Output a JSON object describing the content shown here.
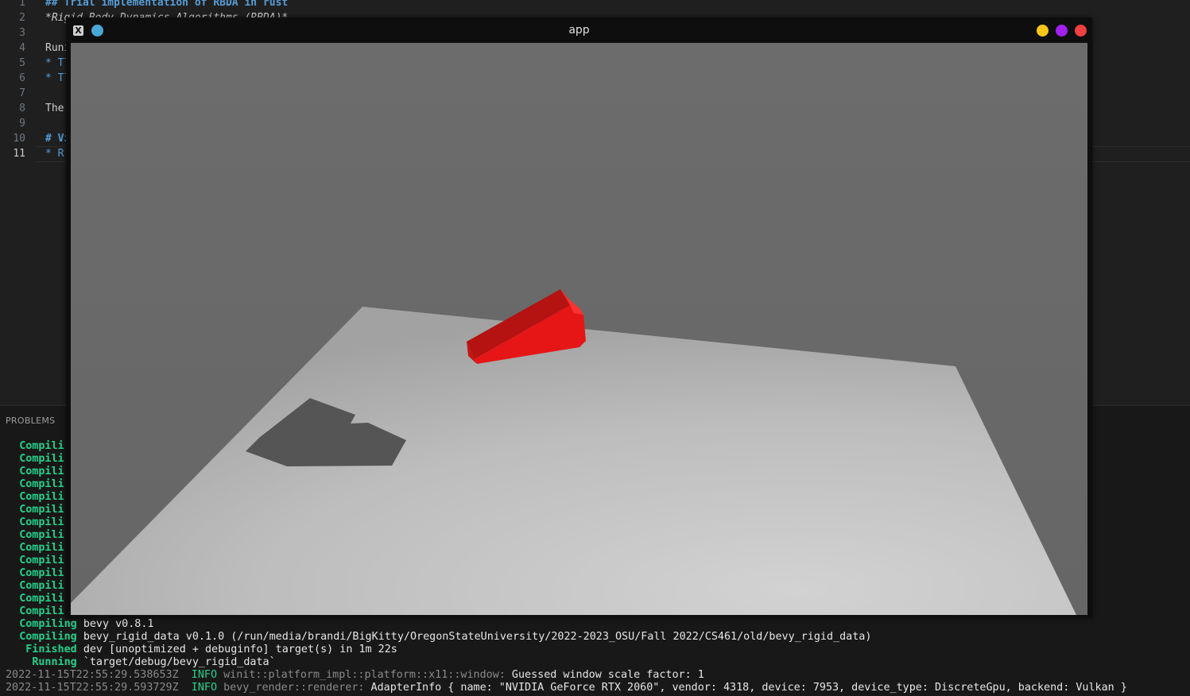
{
  "editor": {
    "line_numbers": [
      "1",
      "2",
      "3",
      "4",
      "5",
      "6",
      "7",
      "8",
      "9",
      "10",
      "11"
    ],
    "lines": [
      {
        "text": "## Trial implementation of RBDA in rust",
        "style": "h"
      },
      {
        "text": "*Rigid Body Dynamics Algorithms (RBDA)*",
        "style": "i"
      },
      {
        "text": "",
        "style": ""
      },
      {
        "text": "Runi",
        "style": ""
      },
      {
        "text": "* Tl",
        "style": "b"
      },
      {
        "text": "* Tl",
        "style": "b"
      },
      {
        "text": "",
        "style": ""
      },
      {
        "text": "The",
        "style": ""
      },
      {
        "text": "",
        "style": ""
      },
      {
        "text": "# Vi",
        "style": "h"
      },
      {
        "text": "* R(",
        "style": "b"
      }
    ]
  },
  "panel": {
    "tab_label": "PROBLEMS",
    "compiling_truncated": "Compili",
    "compiling_count": 14,
    "lines": [
      {
        "kw": "Compiling",
        "text": "bevy v0.8.1"
      },
      {
        "kw": "Compiling",
        "text": "bevy_rigid_data v0.1.0 (/run/media/brandi/BigKitty/OregonStateUniversity/2022-2023_OSU/Fall 2022/CS461/old/bevy_rigid_data)"
      },
      {
        "kw": "Finished",
        "text": "dev [unoptimized + debuginfo] target(s) in 1m 22s"
      },
      {
        "kw": "Running",
        "text": "`target/debug/bevy_rigid_data`"
      }
    ],
    "logs": [
      {
        "ts": "2022-11-15T22:55:29.538653Z",
        "level": "INFO",
        "target": "winit::platform_impl::platform::x11::window:",
        "msg": "Guessed window scale factor: 1"
      },
      {
        "ts": "2022-11-15T22:55:29.593729Z",
        "level": "INFO",
        "target": "bevy_render::renderer:",
        "msg": "AdapterInfo { name: \"NVIDIA GeForce RTX 2060\", vendor: 4318, device: 7953, device_type: DiscreteGpu, backend: Vulkan }"
      }
    ]
  },
  "app_window": {
    "title": "app",
    "x_icon_glyph": "X",
    "buttons": {
      "pin": "#4aa8d8",
      "minimize": "#f5c518",
      "maximize": "#a020f0",
      "close": "#f04040"
    },
    "scene": {
      "background": "#6a6a6a",
      "plane_color": "#c4c4c4",
      "object_color": "#ee1111",
      "shadow_color": "#555555"
    }
  }
}
